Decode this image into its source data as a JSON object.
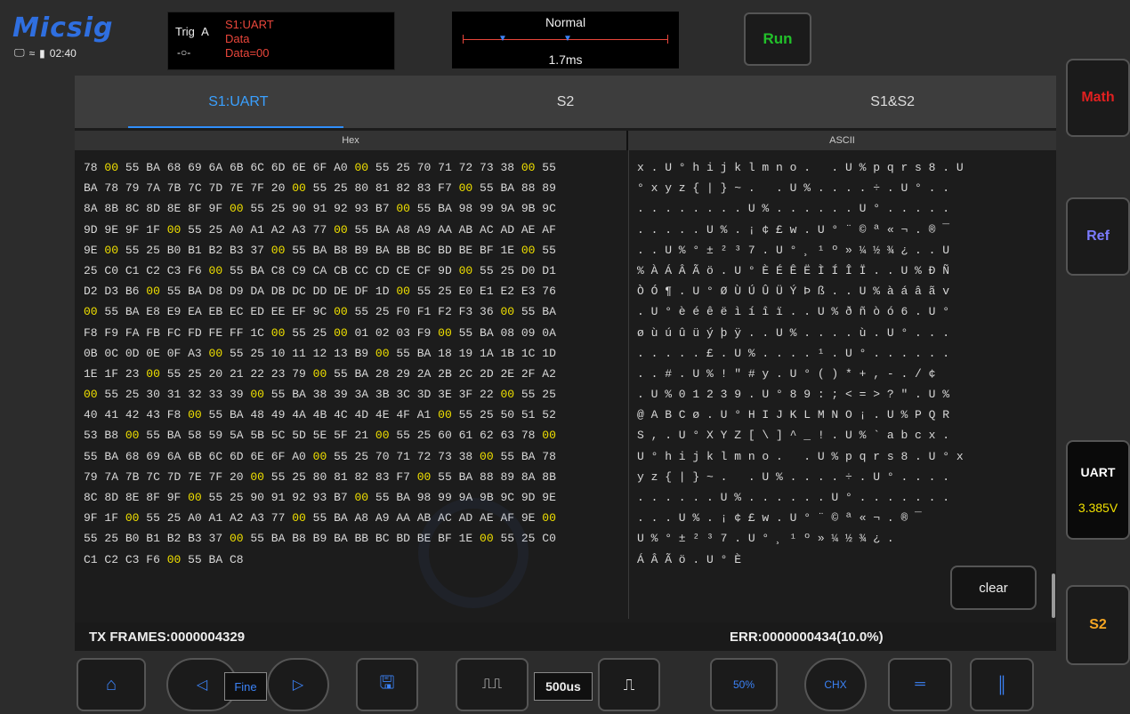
{
  "brand": "Micsig",
  "status": {
    "time": "02:40"
  },
  "trigger": {
    "label": "Trig",
    "channel": "A",
    "source": "S1:UART",
    "type": "Data",
    "value": "Data=00"
  },
  "acquire": {
    "mode": "Normal",
    "time": "1.7ms"
  },
  "run_label": "Run",
  "side": {
    "math": "Math",
    "ref": "Ref",
    "uart": "UART",
    "voltage": "3.385V",
    "s2": "S2",
    "colors": {
      "math": "#e02020",
      "ref": "#7b7bff",
      "uart": "#ffffff",
      "s2": "#f5a623"
    }
  },
  "tabs": [
    "S1:UART",
    "S2",
    "S1&S2"
  ],
  "columns": {
    "hex": "Hex",
    "ascii": "ASCII"
  },
  "hex_rows": [
    "78 00 55 BA 68 69 6A 6B 6C 6D 6E 6F A0 00 55 25 70 71 72 73 38 00 55",
    "BA 78 79 7A 7B 7C 7D 7E 7F 20 00 55 25 80 81 82 83 F7 00 55 BA 88 89",
    "8A 8B 8C 8D 8E 8F 9F 00 55 25 90 91 92 93 B7 00 55 BA 98 99 9A 9B 9C",
    "9D 9E 9F 1F 00 55 25 A0 A1 A2 A3 77 00 55 BA A8 A9 AA AB AC AD AE AF",
    "9E 00 55 25 B0 B1 B2 B3 37 00 55 BA B8 B9 BA BB BC BD BE BF 1E 00 55",
    "25 C0 C1 C2 C3 F6 00 55 BA C8 C9 CA CB CC CD CE CF 9D 00 55 25 D0 D1",
    "D2 D3 B6 00 55 BA D8 D9 DA DB DC DD DE DF 1D 00 55 25 E0 E1 E2 E3 76",
    "00 55 BA E8 E9 EA EB EC ED EE EF 9C 00 55 25 F0 F1 F2 F3 36 00 55 BA",
    "F8 F9 FA FB FC FD FE FF 1C 00 55 25 00 01 02 03 F9 00 55 BA 08 09 0A",
    "0B 0C 0D 0E 0F A3 00 55 25 10 11 12 13 B9 00 55 BA 18 19 1A 1B 1C 1D",
    "1E 1F 23 00 55 25 20 21 22 23 79 00 55 BA 28 29 2A 2B 2C 2D 2E 2F A2",
    "00 55 25 30 31 32 33 39 00 55 BA 38 39 3A 3B 3C 3D 3E 3F 22 00 55 25",
    "40 41 42 43 F8 00 55 BA 48 49 4A 4B 4C 4D 4E 4F A1 00 55 25 50 51 52",
    "53 B8 00 55 BA 58 59 5A 5B 5C 5D 5E 5F 21 00 55 25 60 61 62 63 78 00",
    "55 BA 68 69 6A 6B 6C 6D 6E 6F A0 00 55 25 70 71 72 73 38 00 55 BA 78",
    "79 7A 7B 7C 7D 7E 7F 20 00 55 25 80 81 82 83 F7 00 55 BA 88 89 8A 8B",
    "8C 8D 8E 8F 9F 00 55 25 90 91 92 93 B7 00 55 BA 98 99 9A 9B 9C 9D 9E",
    "9F 1F 00 55 25 A0 A1 A2 A3 77 00 55 BA A8 A9 AA AB AC AD AE AF 9E 00",
    "55 25 B0 B1 B2 B3 37 00 55 BA B8 B9 BA BB BC BD BE BF 1E 00 55 25 C0",
    "C1 C2 C3 F6 00 55 BA C8"
  ],
  "ascii_rows": [
    "x . U ° h i j k l m n o .   . U % p q r s 8 . U",
    "° x y z { | } ~ .   . U % . . . . ÷ . U ° . .",
    ". . . . . . . . U % . . . . . . U ° . . . . .",
    ". . . . . U % . ¡ ¢ £ w . U ° ¨ © ª « ¬ . ® ¯",
    ". . U % ° ± ² ³ 7 . U ° ¸ ¹ º » ¼ ½ ¾ ¿ . . U",
    "% À Á Â Ã ö . U ° È É Ê Ë Ì Í Î Ï . . U % Ð Ñ",
    "Ò Ó ¶ . U ° Ø Ù Ú Û Ü Ý Þ ß . . U % à á â ã v",
    ". U ° è é ê ë ì í î ï . . U % ð ñ ò ó 6 . U °",
    "ø ù ú û ü ý þ ÿ . . U % . . . . ù . U ° . . .",
    ". . . . . £ . U % . . . . ¹ . U ° . . . . . .",
    ". . # . U % ! \" # y . U ° ( ) * + , - . / ¢",
    ". U % 0 1 2 3 9 . U ° 8 9 : ; < = > ? \" . U %",
    "@ A B C ø . U ° H I J K L M N O ¡ . U % P Q R",
    "S , . U ° X Y Z [ \\ ] ^ _ ! . U % ` a b c x .",
    "U ° h i j k l m n o .   . U % p q r s 8 . U ° x",
    "y z { | } ~ .   . U % . . . . ÷ . U ° . . . .",
    ". . . . . . U % . . . . . . U ° . . . . . . .",
    ". . . U % . ¡ ¢ £ w . U ° ¨ © ª « ¬ . ® ¯",
    "U % ° ± ² ³ 7 . U ° ¸ ¹ º » ¼ ½ ¾ ¿ .",
    "Á Â Ã ö . U ° È"
  ],
  "clear_label": "clear",
  "footer": {
    "tx": "TX FRAMES:0000004329",
    "err": "ERR:0000000434(10.0%)"
  },
  "toolbar": {
    "fine": "Fine",
    "timebase": "500us",
    "fifty": "50%",
    "chx": "CHX"
  }
}
